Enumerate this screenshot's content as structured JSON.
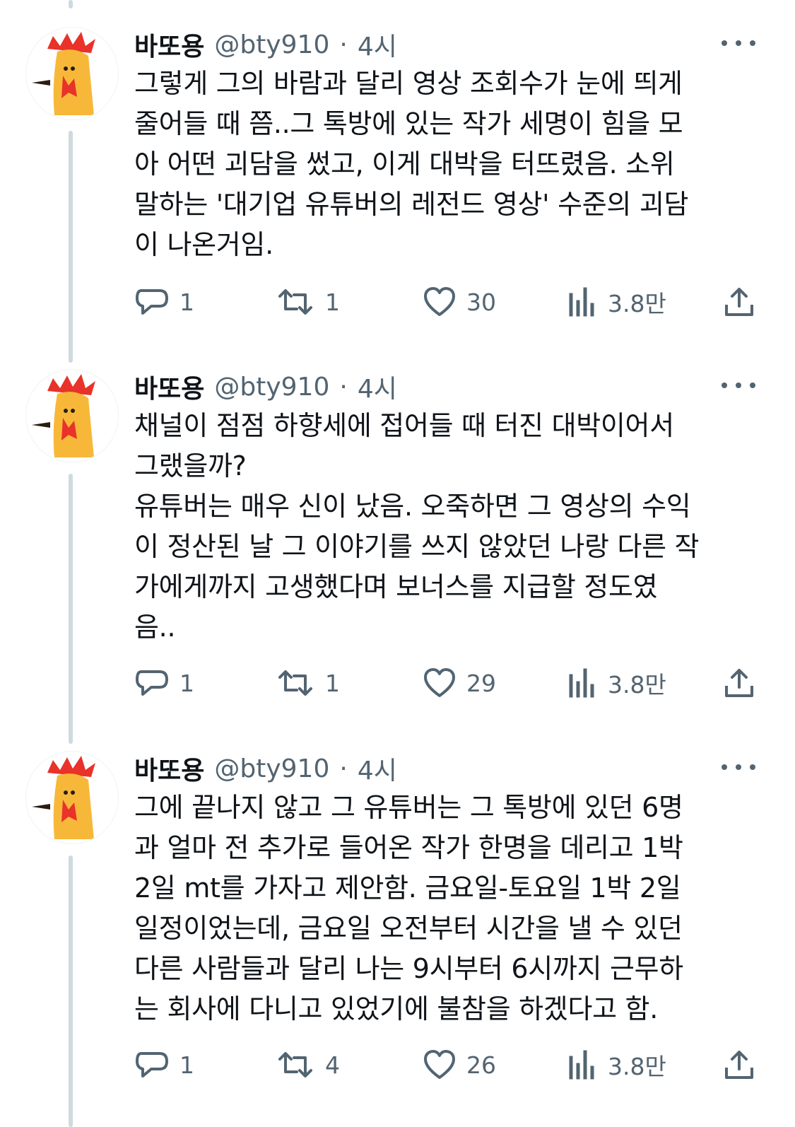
{
  "tweets": [
    {
      "author": {
        "name": "바또용",
        "handle": "@bty910",
        "separator": "·",
        "time": "4시"
      },
      "text": "그렇게 그의 바람과 달리 영상 조회수가 눈에 띄게\n줄어들 때 쯤..그 톡방에 있는 작가 세명이 힘을 모\n아 어떤 괴담을 썼고, 이게 대박을 터뜨렸음. 소위\n말하는 '대기업 유튜버의 레전드 영상' 수준의 괴담\n이 나온거임.",
      "stats": {
        "replies": "1",
        "retweets": "1",
        "likes": "30",
        "views": "3.8만"
      }
    },
    {
      "author": {
        "name": "바또용",
        "handle": "@bty910",
        "separator": "·",
        "time": "4시"
      },
      "text": "채널이 점점 하향세에 접어들 때 터진 대박이어서\n그랬을까?\n유튜버는 매우 신이 났음. 오죽하면 그 영상의 수익\n이 정산된 날 그 이야기를 쓰지 않았던 나랑 다른 작\n가에게까지 고생했다며 보너스를 지급할 정도였\n음..",
      "stats": {
        "replies": "1",
        "retweets": "1",
        "likes": "29",
        "views": "3.8만"
      }
    },
    {
      "author": {
        "name": "바또용",
        "handle": "@bty910",
        "separator": "·",
        "time": "4시"
      },
      "text": "그에 끝나지 않고 그 유튜버는 그 톡방에 있던 6명\n과 얼마 전 추가로 들어온 작가 한명을 데리고 1박\n2일 mt를 가자고 제안함. 금요일-토요일 1박 2일\n일정이었는데, 금요일 오전부터 시간을 낼 수 있던\n다른 사람들과 달리 나는 9시부터 6시까지 근무하\n는 회사에 다니고 있었기에 불참을 하겠다고 함.",
      "stats": {
        "replies": "1",
        "retweets": "4",
        "likes": "26",
        "views": "3.8만"
      }
    }
  ],
  "icons": {
    "reply": "reply-icon",
    "retweet": "retweet-icon",
    "like": "heart-icon",
    "views": "views-chart-icon",
    "share": "share-icon",
    "more": "more-icon",
    "avatar": "rooster-avatar"
  },
  "colors": {
    "text": "#0f1419",
    "secondary": "#536471",
    "thread_line": "#cfd9de",
    "avatar_comb": "#e8322a",
    "avatar_face": "#f7b83a"
  }
}
